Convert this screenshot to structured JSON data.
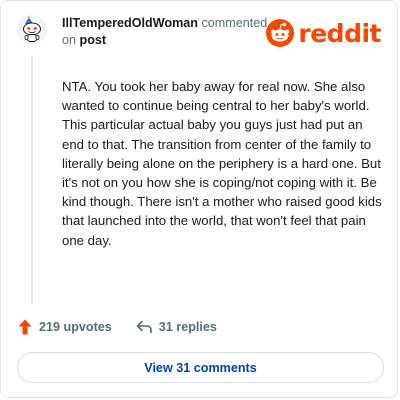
{
  "comment": {
    "author": "IllTemperedOldWoman",
    "action_text": "commented",
    "on_text": "on",
    "target_text": "post",
    "body": "NTA. You took her baby away for real now. She also wanted to continue being central to her baby's world. This particular actual baby you guys just had put an end to that. The transition from center of the family to literally being alone on the periphery is a hard one. But it's not on you how she is coping/not coping with it. Be kind though. There isn't a mother who raised good kids that launched into the world, that won't feel that pain one day.",
    "avatar_icon": "snoo-avatar-icon"
  },
  "brand": {
    "name": "reddit",
    "color": "#ff4500",
    "icon": "reddit-snoo-icon"
  },
  "actions": {
    "upvotes_label": "219 upvotes",
    "upvote_icon": "upvote-arrow-icon",
    "upvote_color": "#ff4500",
    "replies_label": "31 replies",
    "reply_icon": "reply-arrow-icon"
  },
  "footer": {
    "view_comments_label": "View 31 comments",
    "link_color": "#0045ac"
  }
}
